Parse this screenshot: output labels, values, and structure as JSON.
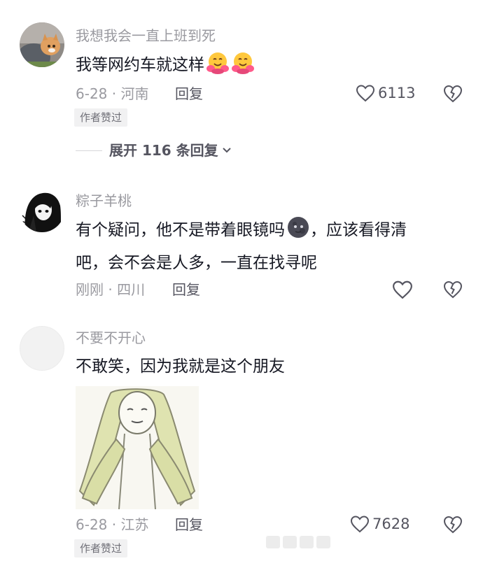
{
  "comments": [
    {
      "username": "我想我会一直上班到死",
      "text": "我等网约车就这样",
      "emojis": [
        "hugging-face-emoji",
        "hugging-face-emoji"
      ],
      "date_location": "6-28 · 河南",
      "reply_label": "回复",
      "likes": "6113",
      "badge": "作者赞过",
      "expand_label": "展开 116 条回复"
    },
    {
      "username": "粽子羊桃",
      "text_line1": "有个疑问，他不是带着眼镜吗",
      "emoji": "new-moon-face-emoji",
      "text_line1_end": "，应该看得清",
      "text_line2": "吧，会不会是人多，一直在找寻呢",
      "date_location": "刚刚 · 四川",
      "reply_label": "回复",
      "likes": ""
    },
    {
      "username": "不要不开心",
      "text": "不敢笑，因为我就是这个朋友",
      "image": "meme-drawing-girl-with-long-hair",
      "date_location": "6-28 · 江苏",
      "reply_label": "回复",
      "likes": "7628",
      "badge": "作者赞过"
    }
  ],
  "colors": {
    "text": "#161823",
    "muted": "#9a9aa0",
    "action": "#555560",
    "badge_bg": "#f1f1f2"
  }
}
